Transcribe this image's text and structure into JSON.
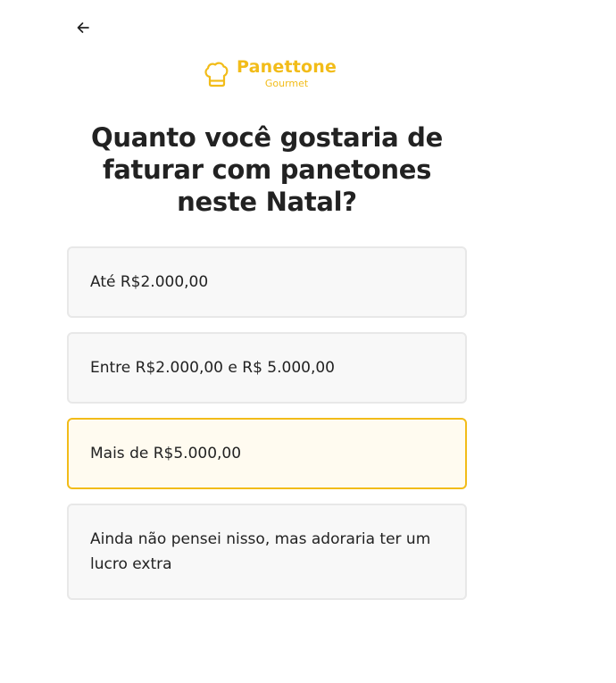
{
  "header": {
    "back_icon": "arrow-left-icon"
  },
  "logo": {
    "icon": "chef-hat-icon",
    "title": "Panettone",
    "subtitle": "Gourmet",
    "color": "#F2BC19"
  },
  "question": {
    "title": "Quanto você gostaria de faturar com panetones neste Natal?"
  },
  "options": [
    {
      "label": "Até R$2.000,00",
      "selected": false
    },
    {
      "label": "Entre R$2.000,00 e R$ 5.000,00",
      "selected": false
    },
    {
      "label": "Mais de R$5.000,00",
      "selected": true
    },
    {
      "label": "Ainda não pensei nisso, mas adoraria ter um lucro extra",
      "selected": false
    }
  ],
  "colors": {
    "accent": "#F2BC19",
    "option_bg": "#F8F8F8",
    "option_border": "#E8E8E8",
    "selected_bg": "#FFFBF0",
    "text": "#222222"
  }
}
